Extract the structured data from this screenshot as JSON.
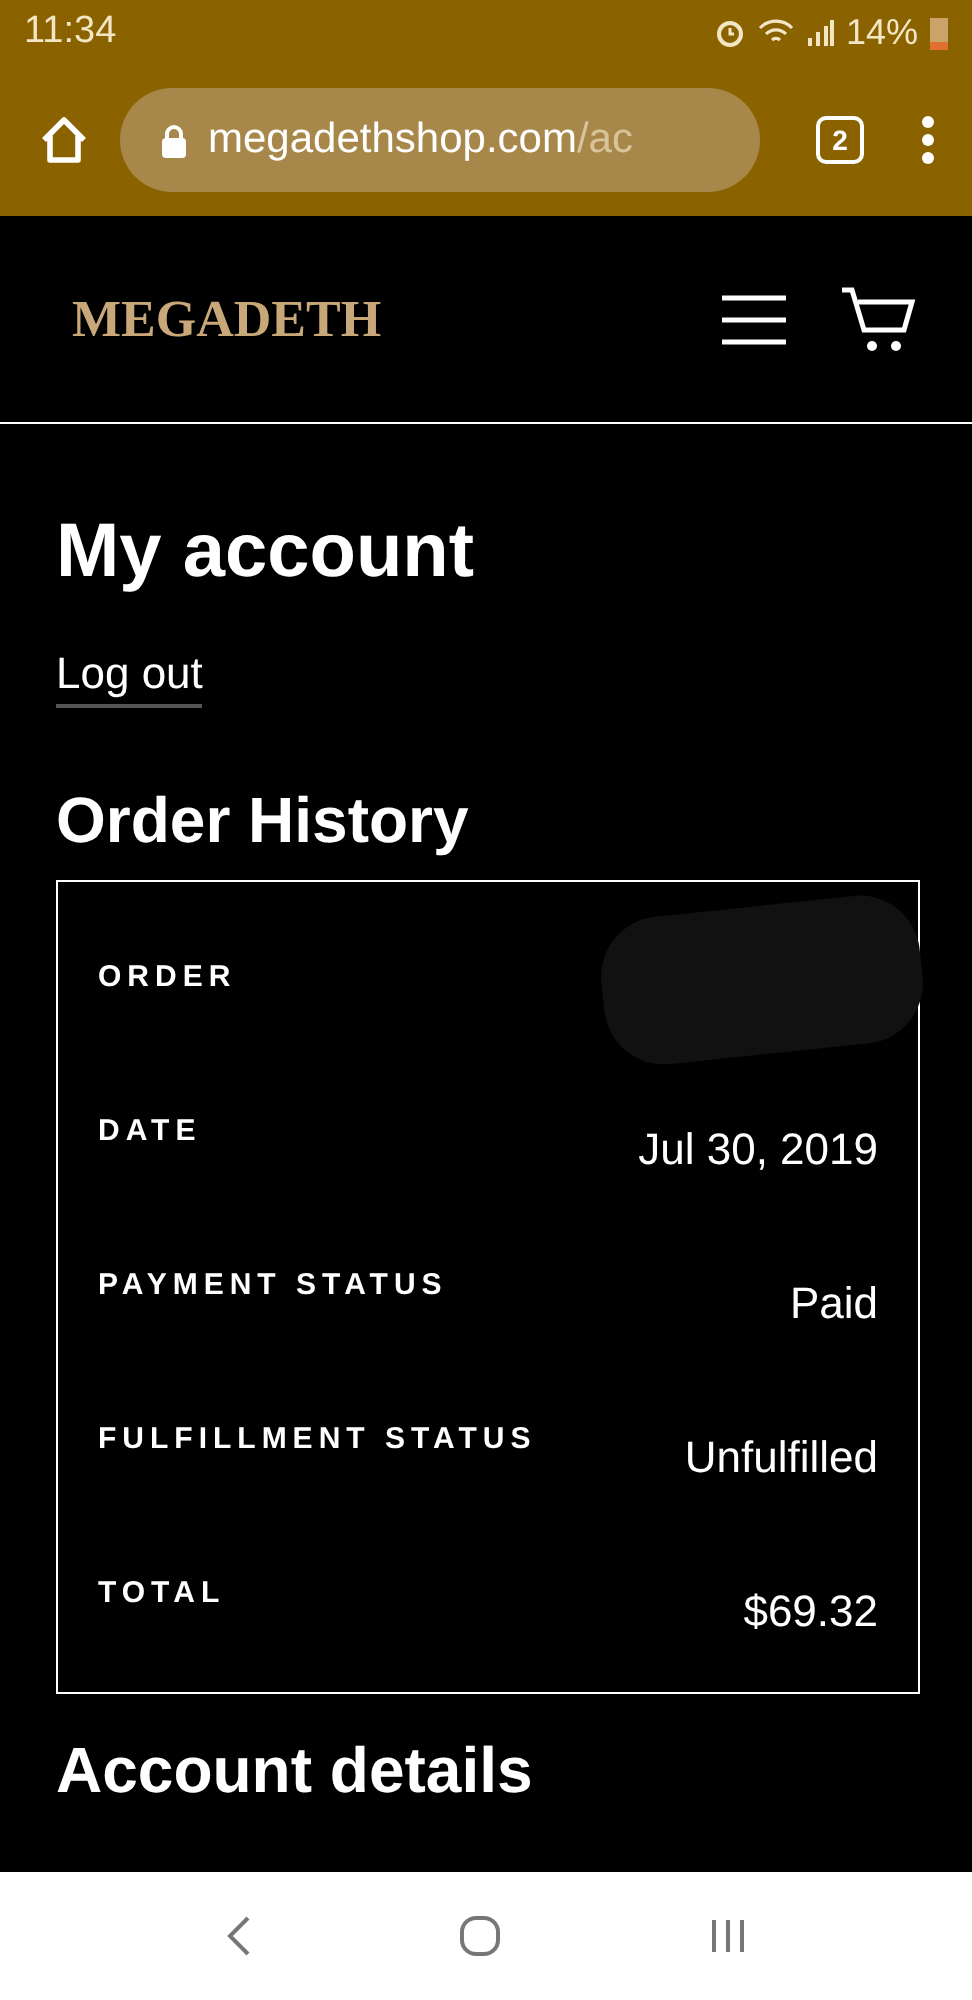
{
  "status_bar": {
    "time": "11:34",
    "battery": "14%"
  },
  "browser": {
    "url_host": "megadethshop.com",
    "url_path": "/ac",
    "tab_count": "2"
  },
  "header": {
    "logo": "MEGADETH"
  },
  "page": {
    "title": "My account",
    "logout": "Log out",
    "section": "Order History",
    "order_rows": [
      {
        "label": "ORDER",
        "redacted": true
      },
      {
        "label": "DATE",
        "value": "Jul 30, 2019",
        "redacted": false
      },
      {
        "label": "PAYMENT STATUS",
        "value": "Paid",
        "redacted": false
      },
      {
        "label": "FULFILLMENT STATUS",
        "value": "Unfulfilled",
        "redacted": false
      },
      {
        "label": "TOTAL",
        "value": "$69.32",
        "redacted": false
      }
    ],
    "next_section": "Account details"
  }
}
